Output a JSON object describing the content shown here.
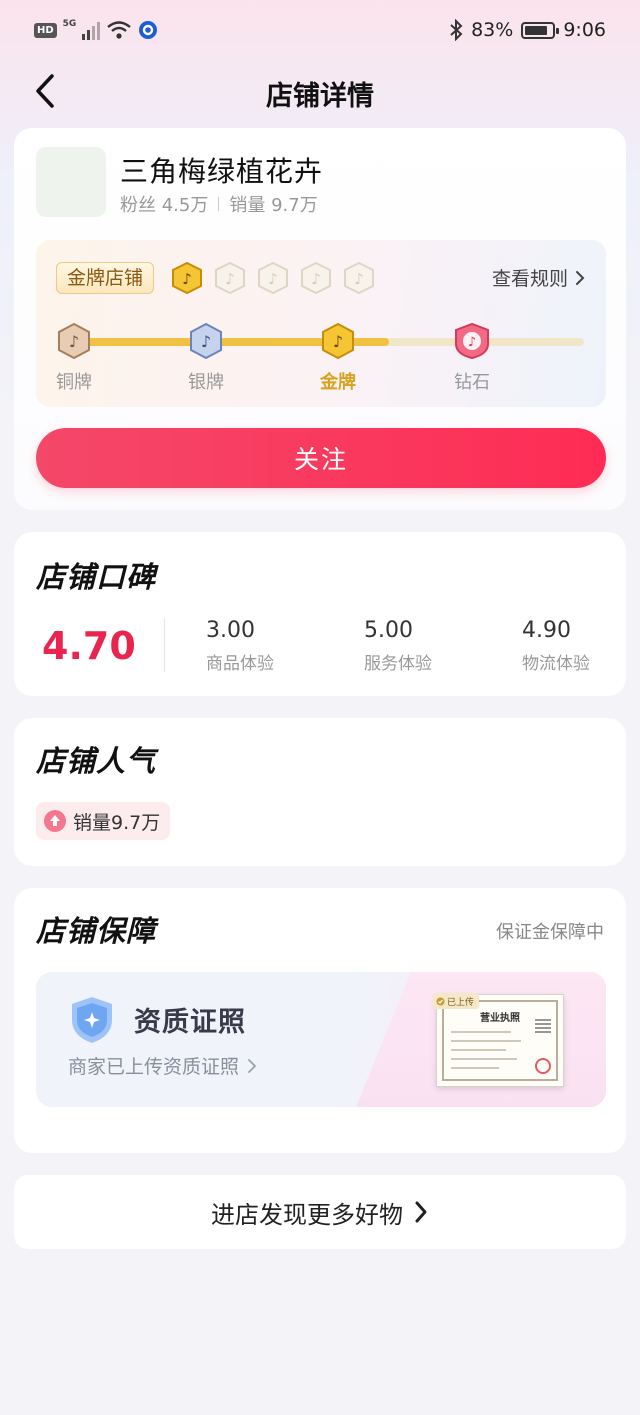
{
  "status_bar": {
    "hd": "HD",
    "network": "5G",
    "battery": "83%",
    "battery_level": 0.83,
    "time": "9:06"
  },
  "nav": {
    "title": "店铺详情",
    "back_icon": "chevron-left-icon"
  },
  "store": {
    "name": "三角梅绿植花卉",
    "fans": "粉丝 4.5万",
    "sales": "销量 9.7万",
    "level_tag": "金牌店铺",
    "rules_label": "查看规则",
    "tier_icons_lit": 1,
    "tier_icons_total": 5,
    "levels": [
      {
        "label": "铜牌",
        "current": false
      },
      {
        "label": "银牌",
        "current": false
      },
      {
        "label": "金牌",
        "current": true
      },
      {
        "label": "钻石",
        "current": false
      }
    ],
    "progress": 0.62,
    "follow_label": "关注"
  },
  "reputation": {
    "title": "店铺口碑",
    "overall": "4.70",
    "items": [
      {
        "value": "3.00",
        "label": "商品体验"
      },
      {
        "value": "5.00",
        "label": "服务体验"
      },
      {
        "value": "4.90",
        "label": "物流体验"
      }
    ]
  },
  "popularity": {
    "title": "店铺人气",
    "badge": "销量9.7万"
  },
  "guarantee": {
    "title": "店铺保障",
    "status": "保证金保障中",
    "cert_title": "资质证照",
    "cert_desc": "商家已上传资质证照",
    "license_tag": "已上传",
    "license_title": "营业执照"
  },
  "footer": {
    "more_label": "进店发现更多好物"
  },
  "colors": {
    "accent": "#fe2c55",
    "gold": "#f0c143",
    "rating": "#e8244f"
  }
}
